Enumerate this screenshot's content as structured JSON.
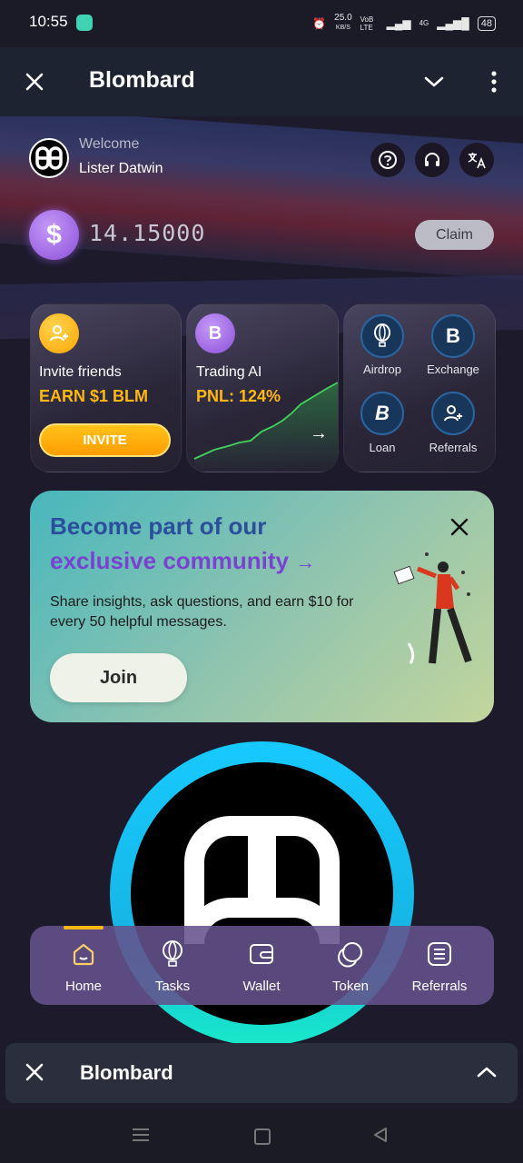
{
  "status_bar": {
    "time": "10:55",
    "net_speed": "25.0",
    "net_unit": "KB/S",
    "volte": "VoB LTE",
    "net_type": "4G",
    "battery": "48"
  },
  "title_bar": {
    "title": "Blombard"
  },
  "header": {
    "welcome": "Welcome",
    "username": "Lister Datwin"
  },
  "balance": {
    "amount": "14.15000",
    "claim_label": "Claim"
  },
  "cards": {
    "invite": {
      "title": "Invite friends",
      "subtitle": "EARN $1 BLM",
      "button": "INVITE"
    },
    "trading": {
      "title": "Trading AI",
      "subtitle": "PNL: 124%"
    },
    "features": [
      {
        "label": "Airdrop"
      },
      {
        "label": "Exchange"
      },
      {
        "label": "Loan"
      },
      {
        "label": "Referrals"
      }
    ]
  },
  "banner": {
    "headline_1": "Become part of our",
    "headline_2": "exclusive community",
    "body": "Share insights, ask questions, and earn $10 for every 50 helpful messages.",
    "join_label": "Join"
  },
  "bottom_nav": [
    {
      "label": "Home"
    },
    {
      "label": "Tasks"
    },
    {
      "label": "Wallet"
    },
    {
      "label": "Token"
    },
    {
      "label": "Referrals"
    }
  ],
  "minimized_bar": {
    "title": "Blombard"
  },
  "colors": {
    "accent_gold": "#ffb812",
    "banner_headline": "#2a4f9c",
    "banner_accent": "#7a43cf"
  },
  "icons": [
    "close-icon",
    "chevron-down-icon",
    "more-vert-icon",
    "help-icon",
    "headset-icon",
    "translate-icon",
    "dollar-icon",
    "arrow-right-icon",
    "balloon-icon",
    "blombard-icon",
    "user-add-icon",
    "wallet-icon",
    "token-icon",
    "list-icon",
    "chevron-up-icon"
  ]
}
